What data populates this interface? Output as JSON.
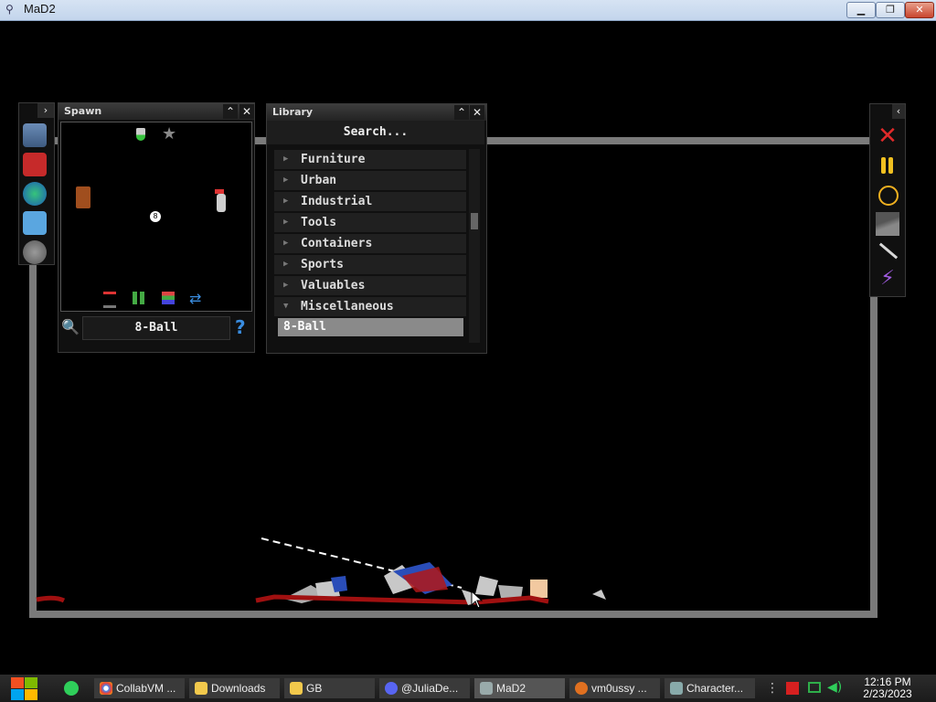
{
  "window": {
    "title": "MaD2",
    "minimize": "▁",
    "restore": "❐",
    "close": "✕"
  },
  "spawn": {
    "title": "Spawn",
    "selected": "8-Ball",
    "help": "?",
    "ball_label": "8"
  },
  "library": {
    "title": "Library",
    "search_placeholder": "Search...",
    "categories": [
      "Furniture",
      "Urban",
      "Industrial",
      "Tools",
      "Containers",
      "Sports",
      "Valuables",
      "Miscellaneous"
    ],
    "selected_item": "8-Ball"
  },
  "taskbar": {
    "items": [
      "CollabVM ...",
      "Downloads",
      "GB",
      "@JuliaDe...",
      "MaD2",
      "vm0ussy ...",
      "Character..."
    ],
    "time": "12:16 PM",
    "date": "2/23/2023"
  },
  "colors": {
    "arena": "#7a7a7a",
    "accent_red": "#d42020",
    "accent_blue": "#2a4db8"
  }
}
